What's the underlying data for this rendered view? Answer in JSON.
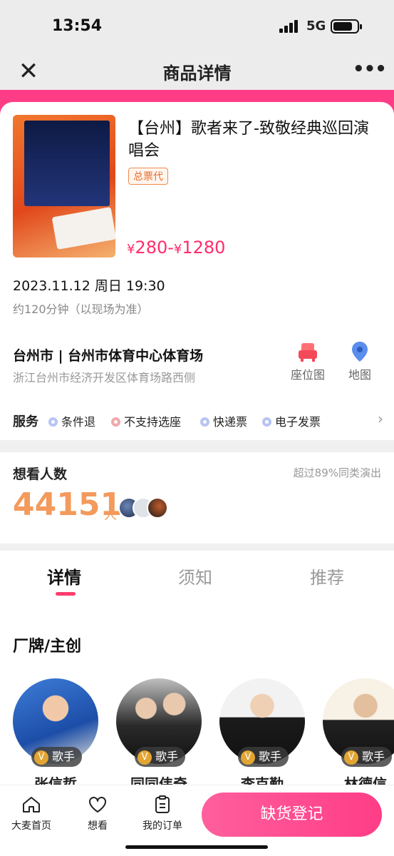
{
  "status_bar": {
    "time": "13:54",
    "network": "5G"
  },
  "nav": {
    "close_icon": "close-icon",
    "title": "商品详情",
    "more_icon": "more-icon"
  },
  "product": {
    "title": "【台州】歌者来了-致敬经典巡回演唱会",
    "tag": "总票代",
    "price": "¥280-¥1280",
    "price_prefix": "¥",
    "price_text": "280-",
    "price_prefix2": "¥",
    "price_text2": "1280",
    "datetime": "2023.11.12 周日 19:30",
    "duration": "约120分钟（以现场为准）"
  },
  "venue": {
    "name": "台州市 | 台州市体育中心体育场",
    "address": "浙江台州市经济开发区体育场路西侧",
    "seatmap_label": "座位图",
    "map_label": "地图"
  },
  "services": {
    "label": "服务",
    "items": [
      {
        "label": "条件退",
        "status": "ok"
      },
      {
        "label": "不支持选座",
        "status": "no"
      },
      {
        "label": "快递票",
        "status": "ok"
      },
      {
        "label": "电子发票",
        "status": "ok"
      }
    ]
  },
  "want": {
    "title": "想看人数",
    "subtitle": "超过89%同类演出",
    "count": "44151",
    "unit": "人"
  },
  "tabs": [
    {
      "label": "详情",
      "active": true
    },
    {
      "label": "须知",
      "active": false
    },
    {
      "label": "推荐",
      "active": false
    }
  ],
  "creators": {
    "title": "厂牌/主创",
    "items": [
      {
        "name": "张信哲",
        "role": "歌手"
      },
      {
        "name": "同同伟奇",
        "role": "歌手"
      },
      {
        "name": "李克勤",
        "role": "歌手"
      },
      {
        "name": "林德信",
        "role": "歌手"
      }
    ]
  },
  "bottom_bar": {
    "home": "大麦首页",
    "want": "想看",
    "orders": "我的订单",
    "cta": "缺货登记"
  },
  "colors": {
    "accent": "#ff3d87",
    "price": "#ff2d6b",
    "want_number": "#f39a5c"
  }
}
